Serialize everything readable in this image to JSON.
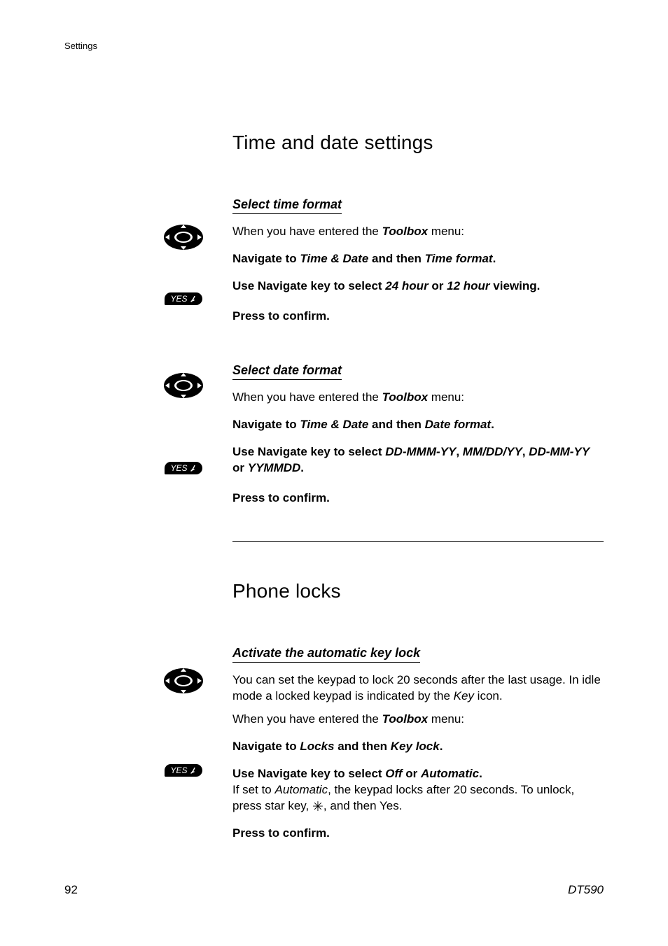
{
  "header": {
    "section_label": "Settings"
  },
  "footer": {
    "page": "92",
    "model": "DT590"
  },
  "section1": {
    "title": "Time and date settings",
    "time": {
      "heading": "Select time format",
      "intro_pre": "When you have entered the ",
      "intro_em": "Toolbox",
      "intro_post": " menu:",
      "nav_pre": "Navigate to ",
      "nav_em1": "Time & Date",
      "nav_mid": " and then ",
      "nav_em2": "Time format",
      "nav_post": ".",
      "sel_pre": "Use Navigate key to select ",
      "sel_em1": "24 hour",
      "sel_mid": " or ",
      "sel_em2": "12 hour",
      "sel_post": " viewing.",
      "confirm": "Press to confirm."
    },
    "date": {
      "heading": "Select date format",
      "intro_pre": "When you have entered the ",
      "intro_em": "Toolbox",
      "intro_post": " menu:",
      "nav_pre": "Navigate to ",
      "nav_em1": "Time & Date",
      "nav_mid": " and then ",
      "nav_em2": "Date format",
      "nav_post": ".",
      "sel_pre": "Use Navigate key to select ",
      "sel_em1": "DD-MMM-YY",
      "sel_s1": ", ",
      "sel_em2": "MM/DD/YY",
      "sel_s2": ", ",
      "sel_em3": "DD-MM-YY",
      "sel_mid": " or ",
      "sel_em4": "YYMMDD",
      "sel_post": ".",
      "confirm": "Press to confirm."
    }
  },
  "section2": {
    "title": "Phone locks",
    "keylock": {
      "heading": "Activate the automatic key lock",
      "desc_pre": "You can set the keypad to lock 20 seconds after the last usage. In idle mode a locked keypad is indicated by the ",
      "desc_em": "Key",
      "desc_post": " icon.",
      "intro_pre": "When you have entered the ",
      "intro_em": "Toolbox",
      "intro_post": " menu:",
      "nav_pre": "Navigate to ",
      "nav_em1": "Locks",
      "nav_mid": " and then ",
      "nav_em2": "Key lock",
      "nav_post": ".",
      "sel_pre": "Use Navigate key to select ",
      "sel_em1": "Off",
      "sel_mid": " or ",
      "sel_em2": "Automatic",
      "sel_post": ".",
      "note_pre": "If set to ",
      "note_em": "Automatic",
      "note_mid": ", the keypad locks after 20 seconds. To unlock, press star key, ",
      "note_post": ", and then Yes.",
      "star": "✳",
      "confirm": "Press to confirm."
    }
  },
  "icons": {
    "yes_label": "YES"
  }
}
